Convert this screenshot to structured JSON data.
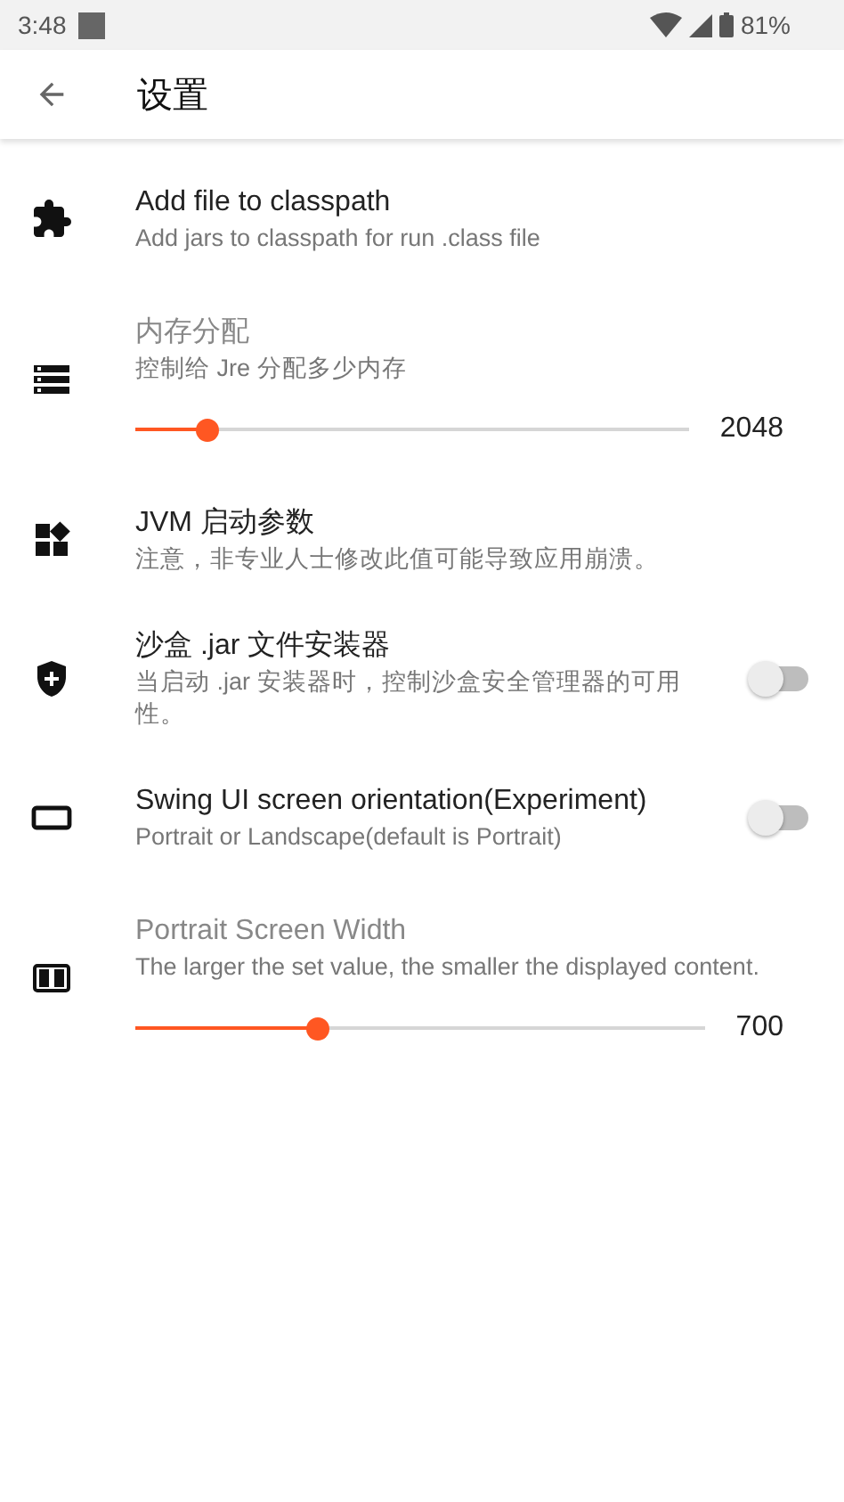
{
  "status_bar": {
    "time": "3:48",
    "battery": "81%"
  },
  "app_bar": {
    "title": "设置"
  },
  "settings": [
    {
      "kind": "link",
      "title": "Add file to classpath",
      "summary": "Add jars to classpath for run .class file"
    },
    {
      "kind": "slider",
      "title": "内存分配",
      "summary": "控制给 Jre 分配多少内存",
      "level": 0.13,
      "reading": "2048"
    },
    {
      "kind": "link",
      "title": "JVM 启动参数",
      "summary": "注意，非专业人士修改此值可能导致应用崩溃。"
    },
    {
      "kind": "switch",
      "title": "沙盒 .jar 文件安装器",
      "summary": "当启动 .jar 安装器时，控制沙盒安全管理器的可用性。",
      "on": false
    },
    {
      "kind": "switch",
      "title": "Swing UI screen orientation(Experiment)",
      "summary": "Portrait or Landscape(default is Portrait)",
      "on": false
    },
    {
      "kind": "slider",
      "title": "Portrait Screen Width",
      "summary": "The larger the set value, the smaller the displayed content.",
      "level": 0.32,
      "reading": "700"
    }
  ]
}
